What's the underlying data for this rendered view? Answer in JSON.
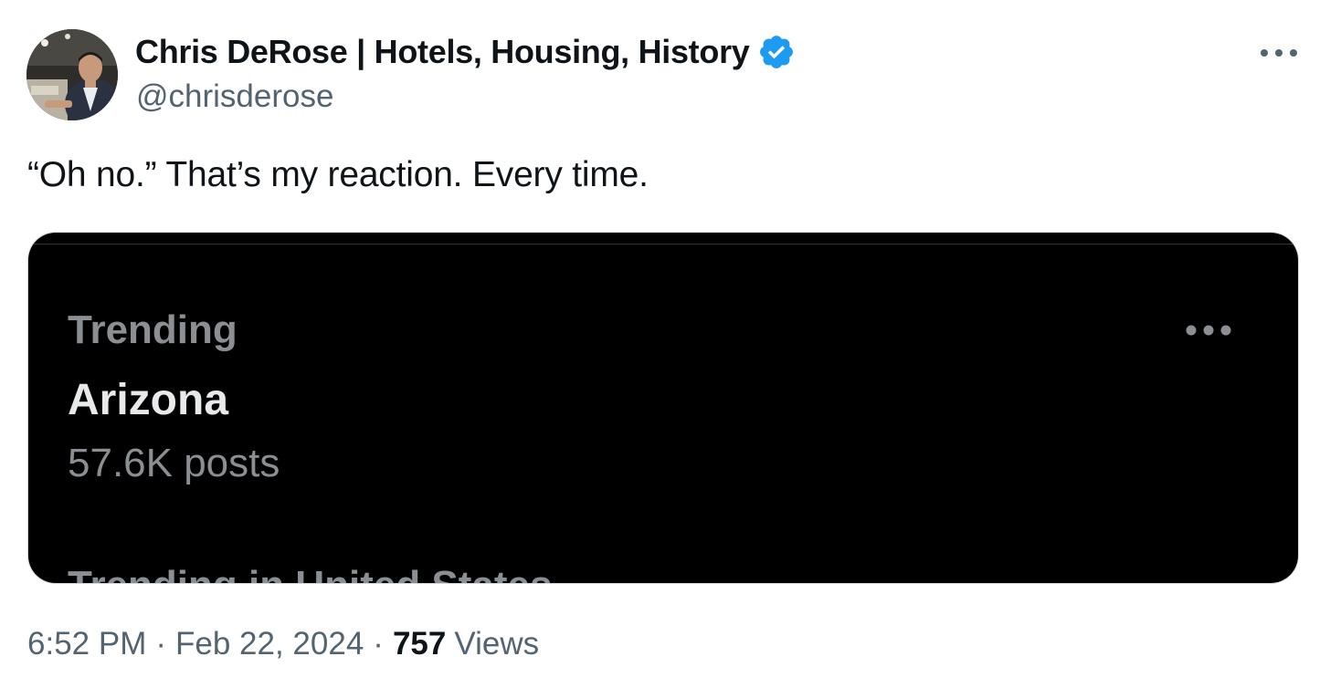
{
  "author": {
    "display_name": "Chris DeRose | Hotels, Housing, History",
    "handle": "@chrisderose",
    "verified": true,
    "avatar": "profile-photo"
  },
  "tweet": {
    "text": "“Oh no.” That’s my reaction. Every time."
  },
  "media": {
    "trend_context": "Trending",
    "trend_name": "Arizona",
    "trend_posts": "57.6K posts",
    "next_trend_partial": "Trending in United States"
  },
  "meta": {
    "time": "6:52 PM",
    "separator": "·",
    "date": "Feb 22, 2024",
    "views_count": "757",
    "views_label": "Views"
  },
  "icons": {
    "verified": "verified-badge-icon",
    "more": "more-horizontal-icon"
  },
  "colors": {
    "verified_blue": "#1d9bf0",
    "secondary_text": "#536471",
    "primary_text": "#0f1419",
    "card_background": "#000000"
  }
}
